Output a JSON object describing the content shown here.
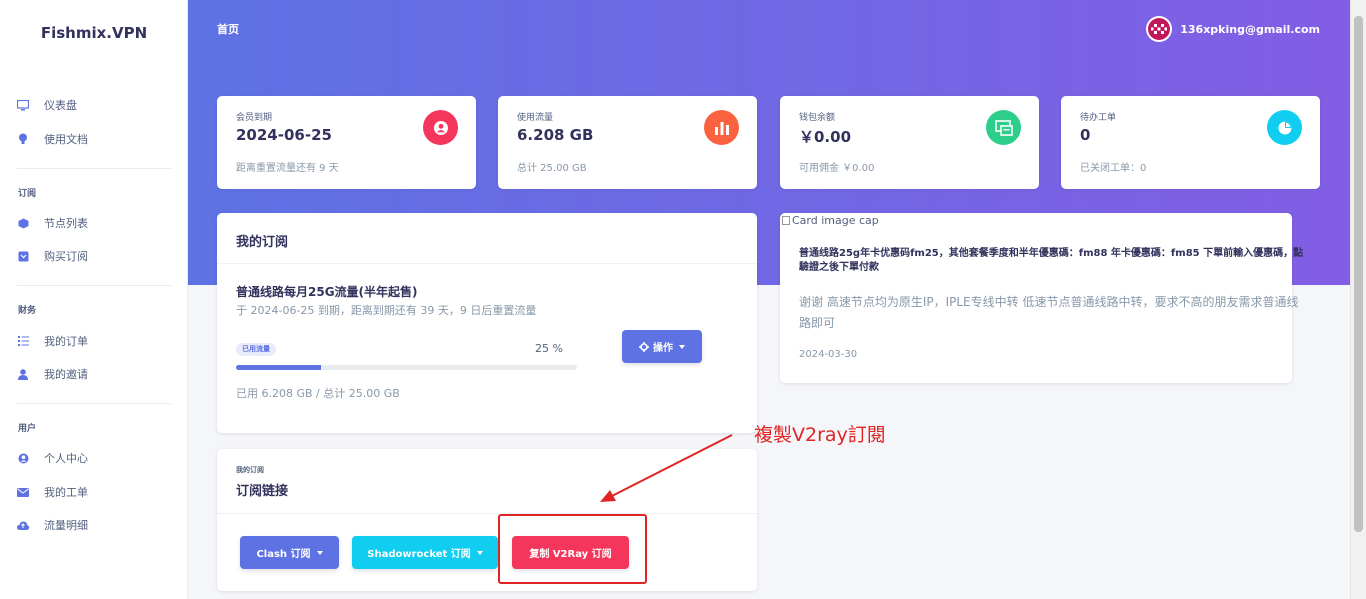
{
  "brand": "Fishmix.VPN",
  "sidebar": {
    "items": [
      {
        "label": "仪表盘",
        "icon": "monitor-icon"
      },
      {
        "label": "使用文档",
        "icon": "bulb-icon"
      },
      {
        "label": "节点列表",
        "icon": "cube-icon"
      },
      {
        "label": "购买订阅",
        "icon": "cart-icon"
      },
      {
        "label": "我的订单",
        "icon": "list-icon"
      },
      {
        "label": "我的邀请",
        "icon": "user-icon"
      },
      {
        "label": "个人中心",
        "icon": "user-circle-icon"
      },
      {
        "label": "我的工单",
        "icon": "mail-icon"
      },
      {
        "label": "流量明细",
        "icon": "cloud-icon"
      }
    ],
    "headings": [
      "订阅",
      "财务",
      "用户"
    ]
  },
  "header": {
    "breadcrumb": "首页",
    "user_email": "136xpking@gmail.com"
  },
  "stats": [
    {
      "label": "会员到期",
      "value": "2024-06-25",
      "sub": "距离重置流量还有 9 天",
      "icon": "user-circle-icon",
      "color": "#f5365c"
    },
    {
      "label": "使用流量",
      "value": "6.208 GB",
      "sub": "总计 25.00 GB",
      "icon": "bar-chart-icon",
      "color": "#fb6340"
    },
    {
      "label": "钱包余额",
      "value": "￥0.00",
      "sub": "可用佣金 ￥0.00",
      "icon": "money-icon",
      "color": "#2dce89"
    },
    {
      "label": "待办工单",
      "value": "0",
      "sub": "已关闭工单：0",
      "icon": "pie-chart-icon",
      "color": "#11cdef"
    }
  ],
  "subscription": {
    "title": "我的订阅",
    "plan_name": "普通线路每月25G流量(半年起售)",
    "plan_desc": "于 2024-06-25 到期，距离到期还有 39 天，9 日后重置流量",
    "badge": "已用流量",
    "percent_label": "25 %",
    "usage_fraction": 0.25,
    "usage_text": "已用 6.208 GB / 总计 25.00 GB",
    "action_button": "操作"
  },
  "links": {
    "subtitle": "我的订阅",
    "title": "订阅链接",
    "clash_button": "Clash 订阅",
    "shadowrocket_button": "Shadowrocket 订阅",
    "v2ray_button": "复制 V2Ray 订阅"
  },
  "annotation": {
    "text": "複製V2ray訂閱",
    "color": "#e02424"
  },
  "announcement": {
    "image_alt": "Card image cap",
    "title": "普通线路25g年卡优惠码fm25，其他套餐季度和半年優惠碼：fm88 年卡優惠碼：fm85 下單前輸入優惠碼，點驗證之後下單付款",
    "body": "谢谢 高速节点均为原生IP，IPLE专线中转 低速节点普通线路中转，要求不高的朋友需求普通线路即可",
    "date": "2024-03-30"
  },
  "colors": {
    "primary": "#5e72e4",
    "info": "#11cdef",
    "danger": "#f5365c"
  }
}
